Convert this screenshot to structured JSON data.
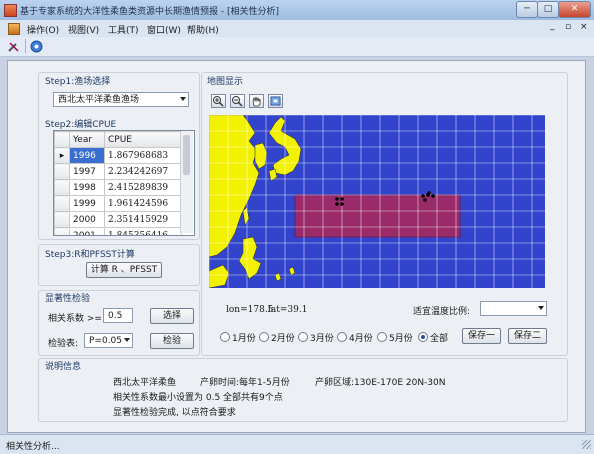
{
  "window": {
    "title": "基于专家系统的大洋性柔鱼类资源中长期渔情预报 - [相关性分析]",
    "controls": {
      "minimize": "─",
      "maximize": "□",
      "close": "✕"
    },
    "mdi_controls": {
      "minimize": "_",
      "restore": "▫",
      "close": "×"
    }
  },
  "menu": {
    "items": [
      {
        "label": "操作(O)"
      },
      {
        "label": "视图(V)"
      },
      {
        "label": "工具(T)"
      },
      {
        "label": "窗口(W)"
      },
      {
        "label": "帮助(H)"
      }
    ]
  },
  "toolbar": {
    "icons": [
      "tools-icon",
      "info-icon"
    ]
  },
  "step1": {
    "label": "Step1:渔场选择",
    "selected": "西北太平洋柔鱼渔场"
  },
  "step2": {
    "label": "Step2:编辑CPUE",
    "columns": [
      "Year",
      "CPUE"
    ],
    "rows": [
      {
        "year": "1996",
        "cpue": "1.867968683"
      },
      {
        "year": "1997",
        "cpue": "2.234242697"
      },
      {
        "year": "1998",
        "cpue": "2.415289839"
      },
      {
        "year": "1999",
        "cpue": "1.961424596"
      },
      {
        "year": "2000",
        "cpue": "2.351415929"
      },
      {
        "year": "2001",
        "cpue": "1.845356416"
      }
    ]
  },
  "step3": {
    "label": "Step3:R和PFSST计算",
    "button": "计算 R 、PFSST"
  },
  "significance": {
    "label": "显著性检验",
    "coef_label": "相关系数 >=",
    "coef_value": "0.5",
    "select_button": "选择",
    "test_label": "检验表:",
    "test_value": "P=0.05",
    "test_button": "检验"
  },
  "map": {
    "label": "地图显示",
    "tools": [
      "zoom-in-icon",
      "zoom-out-icon",
      "pan-hand-icon",
      "full-extent-icon"
    ],
    "lon_text": "lon=178.5",
    "lat_text": "lat=39.1",
    "scale_label": "适宜温度比例:",
    "scale_value": "",
    "colors": {
      "ocean": "#3344cc",
      "land": "#f2f200",
      "region": "#9b2a6a",
      "grid": "#ffffff"
    }
  },
  "months": {
    "options": [
      "1月份",
      "2月份",
      "3月份",
      "4月份",
      "5月份",
      "全部"
    ],
    "selected": "全部",
    "save1": "保存一",
    "save2": "保存二"
  },
  "info": {
    "label": "说明信息",
    "line1_species": "西北太平洋柔鱼",
    "line1_time": "产卵时间:每年1-5月份",
    "line1_area": "产卵区域:130E-170E 20N-30N",
    "line2": "相关性系数最小设置为 0.5  全部共有9个点",
    "line3": "显著性检验完成, 以点符合要求"
  },
  "status": {
    "text": "相关性分析..."
  }
}
